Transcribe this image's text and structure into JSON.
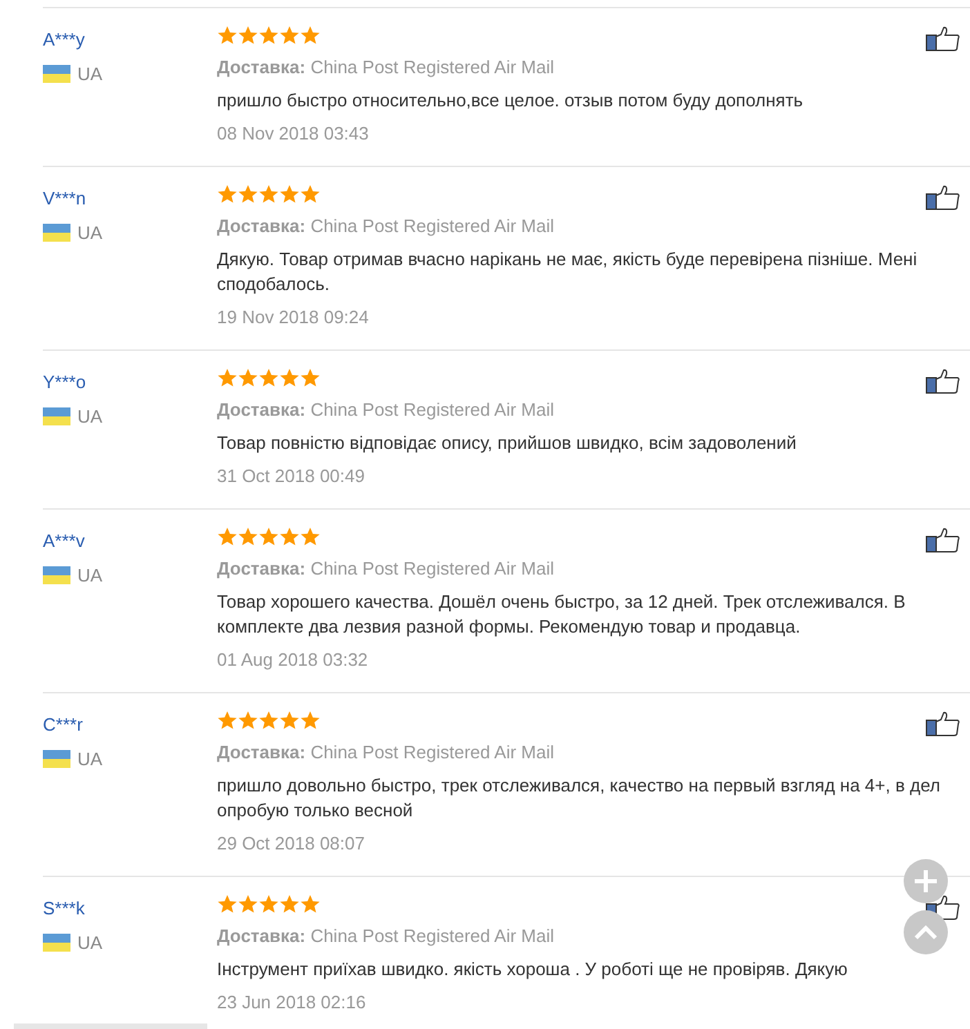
{
  "reviews": [
    {
      "name": "A***y",
      "country": "UA",
      "stars": 5,
      "delivery_label": "Доставка:",
      "delivery": "China Post Registered Air Mail",
      "text": "пришло быстро относительно,все целое. отзыв потом буду дополнять",
      "date": "08 Nov 2018 03:43"
    },
    {
      "name": "V***n",
      "country": "UA",
      "stars": 5,
      "delivery_label": "Доставка:",
      "delivery": "China Post Registered Air Mail",
      "text": "Дякую. Товар отримав вчасно нарікань не має, якість буде перевірена пізніше. Мені\nсподобалось.",
      "date": "19 Nov 2018 09:24"
    },
    {
      "name": "Y***o",
      "country": "UA",
      "stars": 5,
      "delivery_label": "Доставка:",
      "delivery": "China Post Registered Air Mail",
      "text": "Товар повністю відповідає опису, прийшов швидко, всім задоволений",
      "date": "31 Oct 2018 00:49"
    },
    {
      "name": "A***v",
      "country": "UA",
      "stars": 5,
      "delivery_label": "Доставка:",
      "delivery": "China Post Registered Air Mail",
      "text": "Товар хорошего качества. Дошёл очень быстро, за 12 дней. Трек отслеживался. В\nкомплекте два лезвия разной формы. Рекомендую товар и продавца.",
      "date": "01 Aug 2018 03:32"
    },
    {
      "name": "C***r",
      "country": "UA",
      "stars": 5,
      "delivery_label": "Доставка:",
      "delivery": "China Post Registered Air Mail",
      "text": "пришло довольно быстро, трек отслеживался, качество на первый взгляд на 4+, в дел\nопробую только весной",
      "date": "29 Oct 2018 08:07"
    },
    {
      "name": "S***k",
      "country": "UA",
      "stars": 5,
      "delivery_label": "Доставка:",
      "delivery": "China Post Registered Air Mail",
      "text": "Інструмент приїхав швидко. якість хороша . У роботі ще не провіряв. Дякую",
      "date": "23 Jun 2018 02:16"
    }
  ]
}
